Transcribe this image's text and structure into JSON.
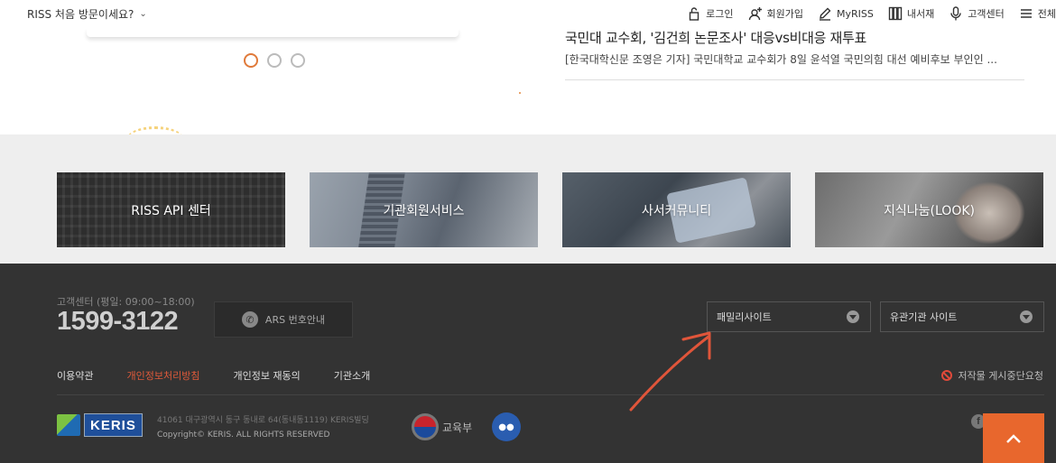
{
  "topbar": {
    "first_visit": "RISS 처음 방문이세요?",
    "menu": [
      {
        "icon": "lock-icon",
        "label": "로그인"
      },
      {
        "icon": "user-plus-icon",
        "label": "회원가입"
      },
      {
        "icon": "pencil-icon",
        "label": "MyRISS"
      },
      {
        "icon": "books-icon",
        "label": "내서재"
      },
      {
        "icon": "microphone-icon",
        "label": "고객센터"
      },
      {
        "icon": "menu-icon",
        "label": "전체"
      }
    ]
  },
  "news": {
    "title": "국민대 교수회, '김건희 논문조사' 대응vs비대응 재투표",
    "desc": "[한국대학신문 조영은 기자] 국민대학교 교수회가 8일 윤석열 국민의힘 대선 예비후보 부인인 ..."
  },
  "services": [
    {
      "label": "RISS API 센터"
    },
    {
      "label": "기관회원서비스"
    },
    {
      "label": "사서커뮤니티"
    },
    {
      "label": "지식나눔(LOOK)"
    }
  ],
  "footer": {
    "cs_label": "고객센터 (평일: 09:00~18:00)",
    "cs_phone": "1599-3122",
    "ars_label": "ARS 번호안내",
    "family_site": "패밀리사이트",
    "related_site": "유관기관 사이트",
    "links": [
      "이용약관",
      "개인정보처리방침",
      "개인정보 재동의",
      "기관소개"
    ],
    "stop_notice": "저작물 게시중단요청",
    "keris": "KERIS",
    "address": "41061 대구광역시 동구 동내로 64(동내동1119) KERIS빌딩",
    "copyright": "Copyright© KERIS. ALL RIGHTS RESERVED",
    "moe": "교육부"
  },
  "colors": {
    "accent": "#e8672d",
    "privacy_link": "#e05a3a",
    "footer_bg": "#333333",
    "service_bg": "#eeeeee",
    "annotation_arrow": "#e0553a"
  }
}
